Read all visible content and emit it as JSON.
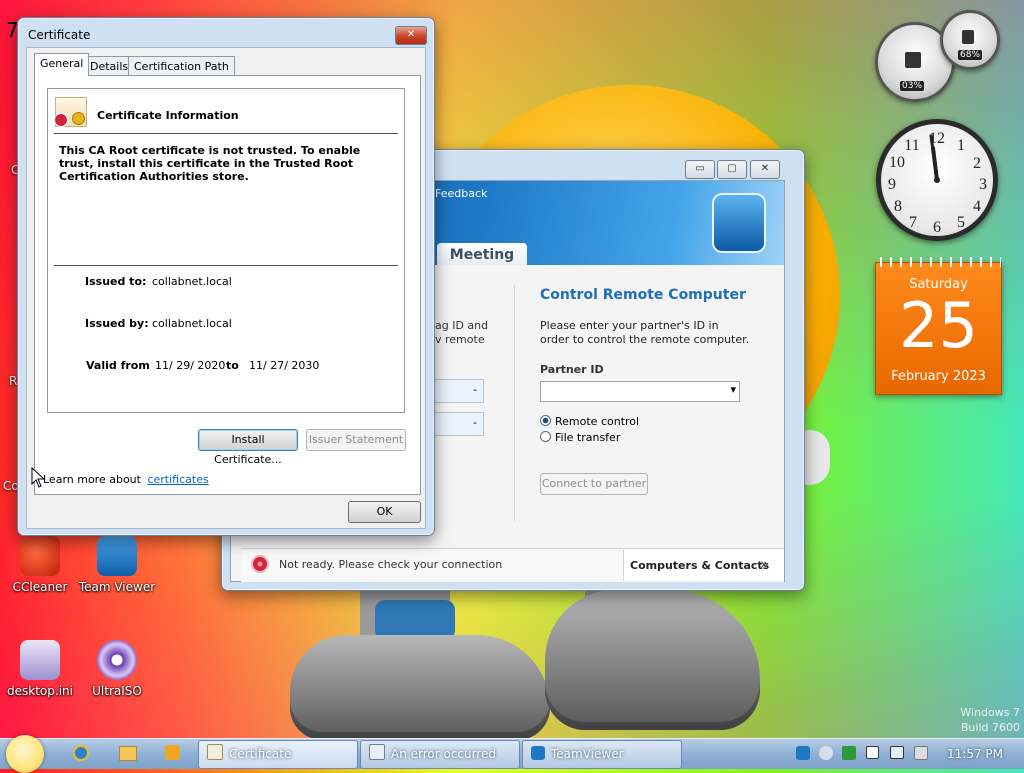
{
  "desktop": {
    "icons": [
      {
        "label": "CCleaner"
      },
      {
        "label": "Team Viewer"
      },
      {
        "label": "desktop.ini"
      },
      {
        "label": "UltraISO"
      }
    ],
    "edge_letters": [
      "7",
      "C",
      "R",
      "Co"
    ],
    "watermark": {
      "line1": "Windows 7",
      "line2": "Build 7600"
    }
  },
  "cert_window": {
    "title": "Certificate",
    "close_glyph": "✕",
    "tabs": [
      {
        "label": "General"
      },
      {
        "label": "Details"
      },
      {
        "label": "Certification Path"
      }
    ],
    "info_heading": "Certificate Information",
    "message": "This CA Root certificate is not trusted. To enable trust, install this certificate in the Trusted Root Certification Authorities store.",
    "issued_to_label": "Issued to:",
    "issued_to_value": "collabnet.local",
    "issued_by_label": "Issued by:",
    "issued_by_value": "collabnet.local",
    "valid_from_label": "Valid from",
    "valid_from_value": "11/ 29/ 2020",
    "valid_to_label": "to",
    "valid_to_value": "11/ 27/ 2030",
    "install_button": "Install Certificate...",
    "issuer_button": "Issuer Statement",
    "learn_more_text": "Learn more about",
    "learn_more_link": "certificates",
    "ok_button": "OK"
  },
  "teamviewer_window": {
    "minimize_glyph": "▭",
    "maximize_glyph": "▢",
    "close_glyph": "✕",
    "menu_feedback": "Feedback",
    "tab_meeting": "Meeting",
    "left_partial_line1": "ag ID and",
    "left_partial_line2": "v remote",
    "left_field_glyph": "-",
    "control_heading": "Control Remote Computer",
    "control_desc": "Please enter your partner's ID in order to control the remote computer.",
    "partner_id_label": "Partner ID",
    "partner_id_value": "",
    "dropdown_glyph": "▾",
    "radio_remote_control": "Remote control",
    "radio_file_transfer": "File transfer",
    "connect_button": "Connect to partner",
    "status_text": "Not ready. Please check your connection",
    "computers_contacts": "Computers & Contacts",
    "chevron": "»"
  },
  "gadgets": {
    "cpu_percent_label": "03%",
    "mem_percent_label": "68%",
    "cpu_level": 0.03,
    "mem_level": 0.68,
    "clock_numbers": [
      "12",
      "1",
      "2",
      "3",
      "4",
      "5",
      "6",
      "7",
      "8",
      "9",
      "10",
      "11"
    ],
    "calendar_day": "Saturday",
    "calendar_date": "25",
    "calendar_month": "February 2023"
  },
  "taskbar": {
    "buttons": [
      {
        "label": "Certificate"
      },
      {
        "label": "An error occurred"
      },
      {
        "label": "TeamViewer"
      }
    ],
    "time": "11:57 PM"
  },
  "colors": {
    "accent_blue": "#1d6fb8",
    "link_blue": "#0066cc",
    "calendar_orange": "#f07a10",
    "status_red": "#d0233c"
  }
}
